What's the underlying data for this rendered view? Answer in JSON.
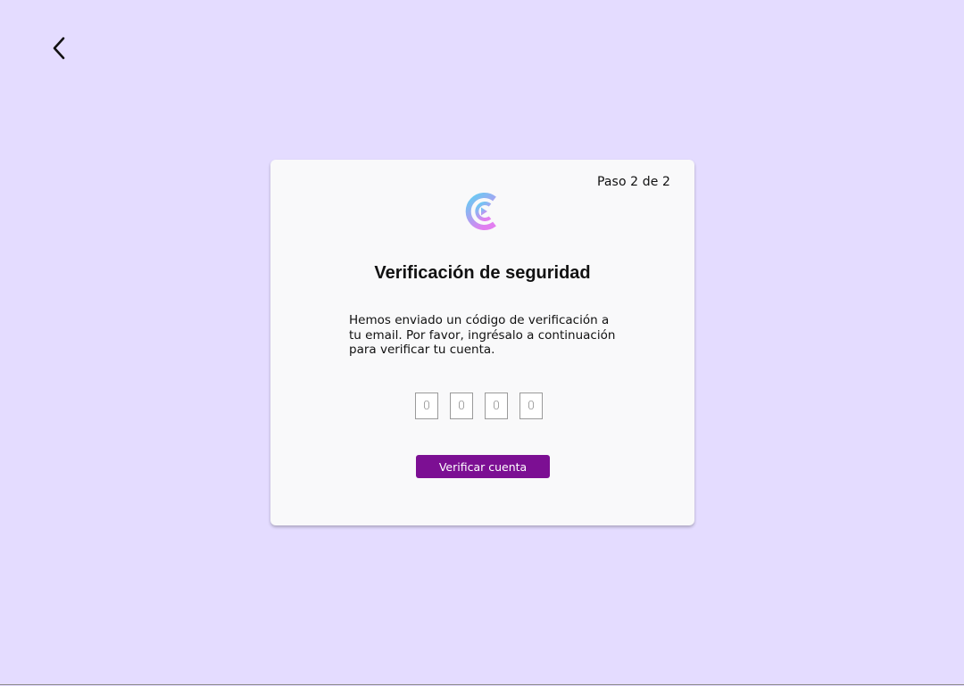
{
  "header": {
    "back_icon": "chevron-left-icon"
  },
  "card": {
    "step_label": "Paso 2 de 2",
    "logo_icon": "brand-logo-icon",
    "title": "Verificación de seguridad",
    "description": "Hemos enviado un código de verificación a\ntu email. Por favor, ingrésalo a continuación\npara verificar tu cuenta.",
    "code_inputs": [
      {
        "placeholder": "0"
      },
      {
        "placeholder": "0"
      },
      {
        "placeholder": "0"
      },
      {
        "placeholder": "0"
      }
    ],
    "submit_label": "Verificar cuenta"
  },
  "colors": {
    "background": "#e4dcff",
    "card": "#f9f9fa",
    "button": "#7c0f93",
    "logo_gradient_start": "#5fd0f3",
    "logo_gradient_end": "#d68cf0"
  }
}
